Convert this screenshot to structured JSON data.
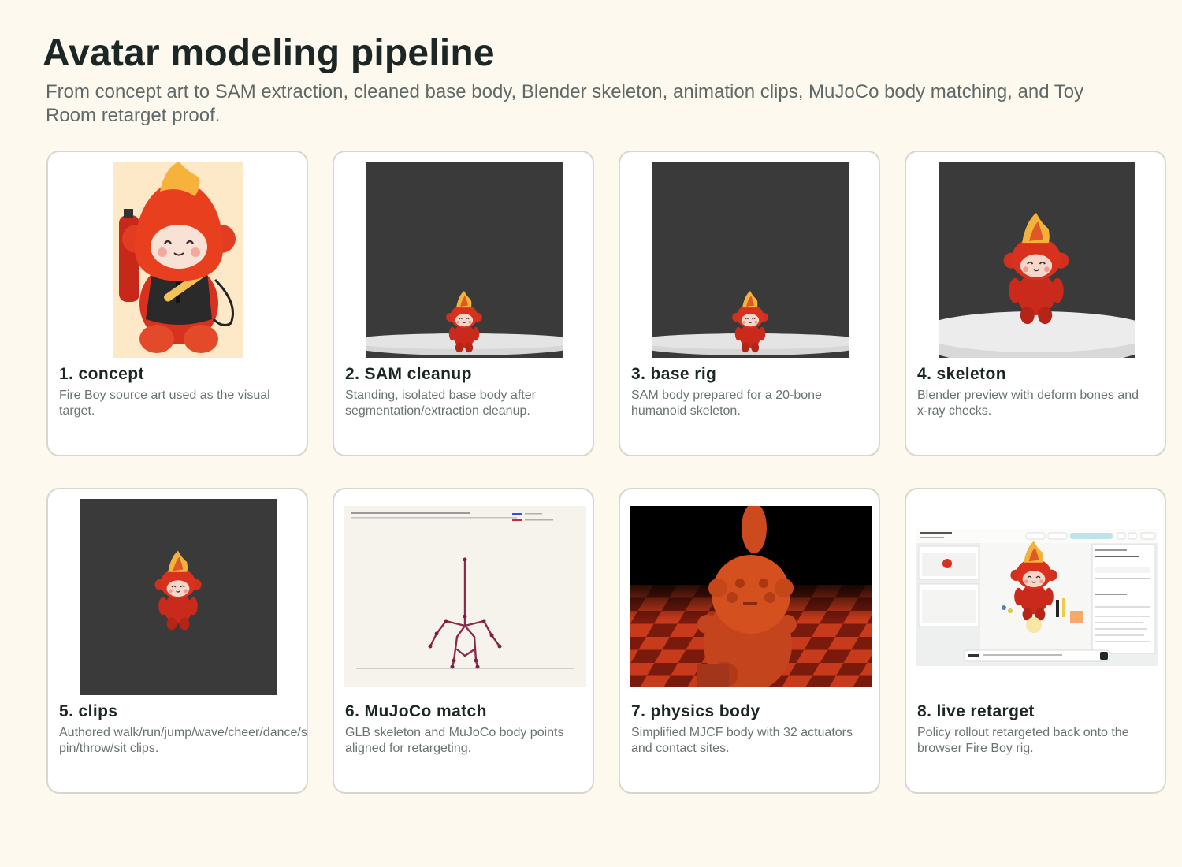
{
  "page": {
    "title": "Avatar modeling pipeline",
    "subtitle": "From concept art to SAM extraction, cleaned base body, Blender skeleton, animation clips, MuJoCo body matching, and Toy Room retarget proof."
  },
  "cards": [
    {
      "title": "1. concept",
      "desc": "Fire Boy source art used as the visual target."
    },
    {
      "title": "2. SAM cleanup",
      "desc": "Standing, isolated base body after segmentation/extraction cleanup."
    },
    {
      "title": "3. base rig",
      "desc": "SAM body prepared for a 20-bone humanoid skeleton."
    },
    {
      "title": "4. skeleton",
      "desc": "Blender preview with deform bones and x-ray checks."
    },
    {
      "title": "5. clips",
      "desc": "Authored walk/run/jump/wave/cheer/dance/spin/throw/sit clips."
    },
    {
      "title": "6. MuJoCo match",
      "desc": "GLB skeleton and MuJoCo body points aligned for retargeting."
    },
    {
      "title": "7. physics body",
      "desc": "Simplified MJCF body with 32 actuators and contact sites."
    },
    {
      "title": "8. live retarget",
      "desc": "Policy rollout retargeted back onto the browser Fire Boy rig."
    }
  ],
  "images": {
    "concept": "fire-boy-plush-concept-art",
    "sam": "fire-boy-sam-extraction-render",
    "rig": "fire-boy-base-rig-render",
    "skeleton": "fire-boy-blender-skeleton-preview",
    "clips": "fire-boy-animation-clip-frame",
    "mujoco": "glb-vs-mujoco-skeleton-plot",
    "physics": "mjcf-physics-body-render",
    "retarget": "toy-room-live-retarget-screenshot"
  },
  "colors": {
    "background": "#fdf9ef",
    "fire_red": "#d8321f",
    "flame_yellow": "#f3b23a",
    "dark_render_bg": "#3a3a3a",
    "skeleton_line": "#8b2b4b"
  }
}
